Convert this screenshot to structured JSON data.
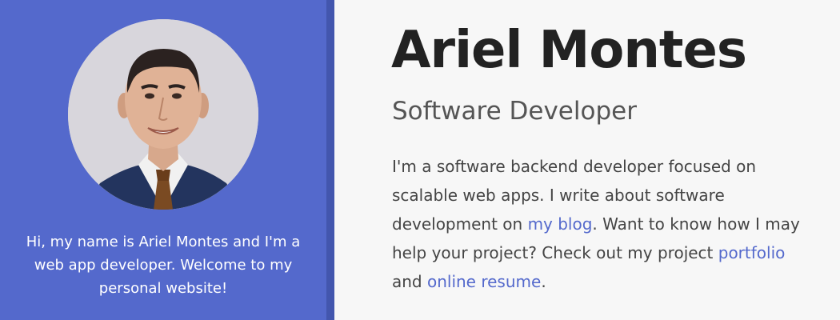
{
  "sidebar": {
    "avatar_alt": "Ariel Montes",
    "intro": "Hi, my name is Ariel Montes and I'm a web app developer. Welcome to my personal website!"
  },
  "header": {
    "name": "Ariel Montes",
    "role": "Software Developer"
  },
  "bio": {
    "part1": "I'm a software backend developer focused on scalable web apps. I write about software development on ",
    "blog_link": "my blog",
    "part2": ". Want to know how I may help your project? Check out my project ",
    "portfolio_link": "portfolio",
    "part3": " and ",
    "resume_link": "online resume",
    "part4": "."
  },
  "colors": {
    "sidebar_bg": "#5469cc",
    "sidebar_border": "#4356ae",
    "link": "#5469cc",
    "heading": "#222222"
  }
}
